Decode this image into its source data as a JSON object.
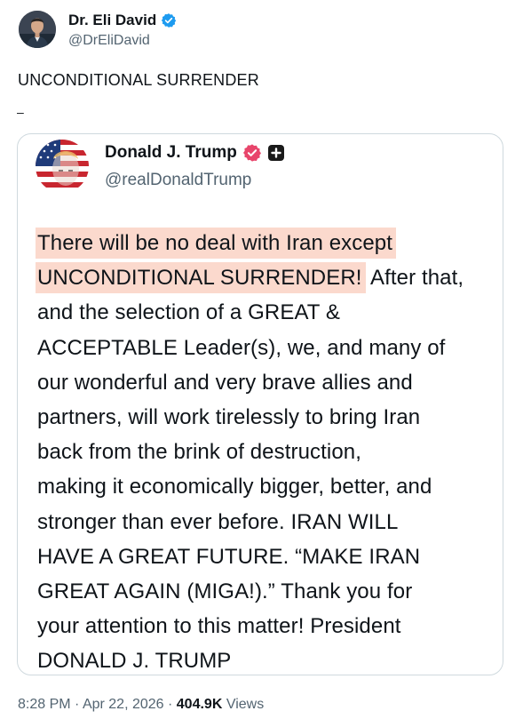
{
  "author": {
    "name": "Dr. Eli David",
    "handle": "@DrEliDavid"
  },
  "post": {
    "text": "UNCONDITIONAL SURRENDER",
    "separator": "–"
  },
  "quoted": {
    "name": "Donald J. Trump",
    "handle": "@realDonaldTrump",
    "body_lines": [
      {
        "highlight": "There will be no deal with Iran except",
        "rest": ""
      },
      {
        "highlight": "UNCONDITIONAL SURRENDER!",
        "rest": " After that,"
      },
      {
        "highlight": "",
        "rest": "and the selection of a GREAT &"
      },
      {
        "highlight": "",
        "rest": "ACCEPTABLE Leader(s), we, and many of"
      },
      {
        "highlight": "",
        "rest": "our wonderful and very brave allies and"
      },
      {
        "highlight": "",
        "rest": "partners, will work tirelessly to bring Iran"
      },
      {
        "highlight": "",
        "rest": "back from the brink of destruction,"
      },
      {
        "highlight": "",
        "rest": "making it economically bigger, better, and"
      },
      {
        "highlight": "",
        "rest": "stronger than ever before. IRAN WILL"
      },
      {
        "highlight": "",
        "rest": "HAVE A GREAT FUTURE. “MAKE IRAN"
      },
      {
        "highlight": "",
        "rest": "GREAT AGAIN (MIGA!).” Thank you for"
      },
      {
        "highlight": "",
        "rest": "your attention to this matter! President"
      },
      {
        "highlight": "",
        "rest": "DONALD J. TRUMP"
      }
    ]
  },
  "meta": {
    "time": "8:28 PM",
    "sep1": " · ",
    "date": "Apr 22, 2026",
    "sep2": " · ",
    "views_count": "404.9K",
    "views_label": " Views"
  },
  "colors": {
    "verified_blue": "#1d9bf0",
    "truth_badge": "#e8456b",
    "highlight": "#fbd9cd",
    "muted_text": "#536471"
  },
  "icons": [
    "verified-badge-icon",
    "truth-verified-icon",
    "plus-box-icon"
  ]
}
